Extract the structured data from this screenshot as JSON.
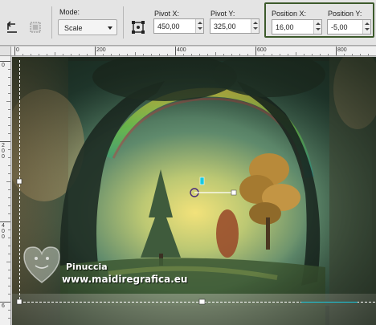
{
  "toolbar": {
    "mode_label": "Mode:",
    "mode_value": "Scale",
    "pivot_x_label": "Pivot X:",
    "pivot_x_value": "450,00",
    "pivot_y_label": "Pivot Y:",
    "pivot_y_value": "325,00",
    "position_x_label": "Position X:",
    "position_x_value": "16,00",
    "position_y_label": "Position Y:",
    "position_y_value": "-5,00"
  },
  "ruler_top": {
    "labels": [
      "0",
      "200",
      "400",
      "600",
      "800"
    ]
  },
  "ruler_left": {
    "labels": [
      "0",
      "2\n0\n0",
      "4\n0\n0",
      "6"
    ]
  },
  "watermark": {
    "line1": "Pinuccia",
    "line2": "www.maidiregrafica.eu"
  },
  "colors": {
    "highlight_border": "#3d5a2c",
    "toolbar_bg": "#e4e4e4",
    "handle_cyan": "#19c9e0"
  }
}
